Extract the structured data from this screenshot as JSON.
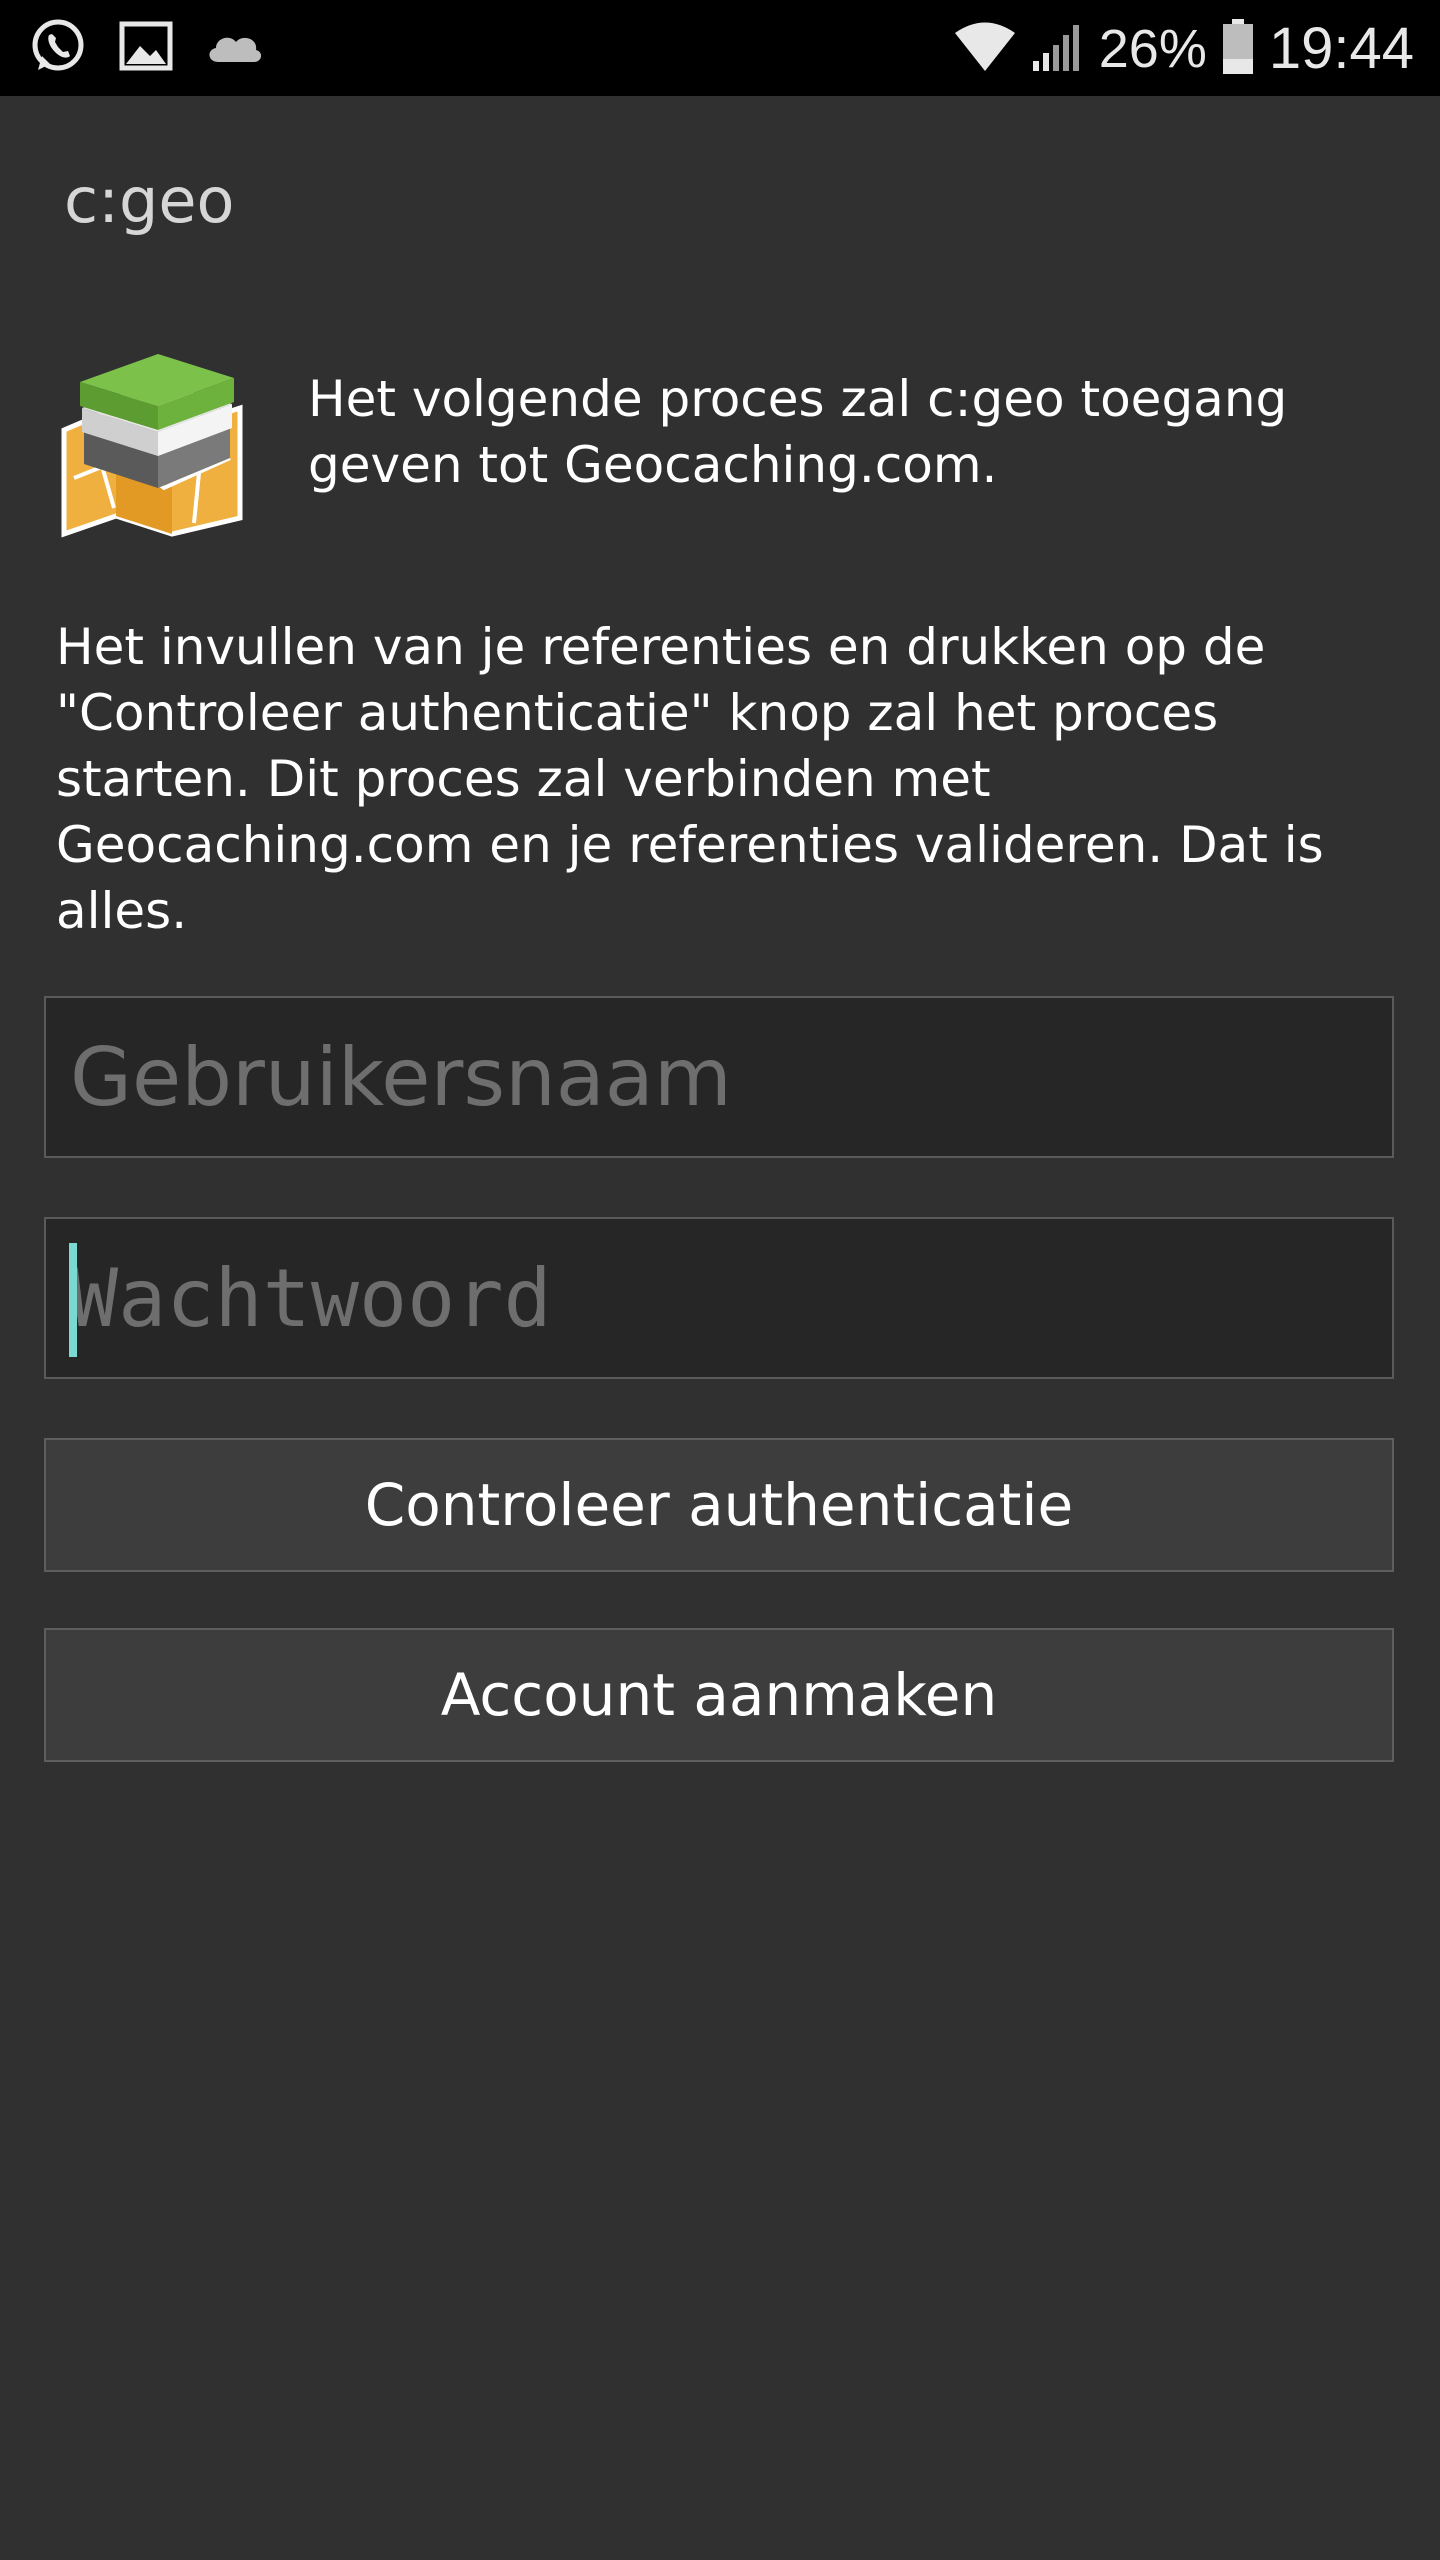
{
  "status_bar": {
    "left_icons": [
      "whatsapp-icon",
      "image-icon",
      "cloud-icon"
    ],
    "battery_percent": "26%",
    "time": "19:44"
  },
  "app": {
    "title": "c:geo"
  },
  "intro": {
    "text": "Het volgende proces zal c:geo toegang geven tot Geocaching.com."
  },
  "explanation": {
    "text": "Het invullen van je referenties en drukken op de \"Controleer authenticatie\" knop zal het proces starten. Dit proces zal verbinden met Geocaching.com en je referenties valideren. Dat is alles."
  },
  "form": {
    "username": {
      "value": "",
      "placeholder": "Gebruikersnaam"
    },
    "password": {
      "value": "",
      "placeholder": "Wachtwoord"
    }
  },
  "buttons": {
    "check_auth": "Controleer authenticatie",
    "create_account": "Account aanmaken"
  },
  "colors": {
    "background": "#303030",
    "status_bar": "#000000",
    "cursor": "#7ad9d0",
    "button_bg": "#3d3d3d"
  }
}
